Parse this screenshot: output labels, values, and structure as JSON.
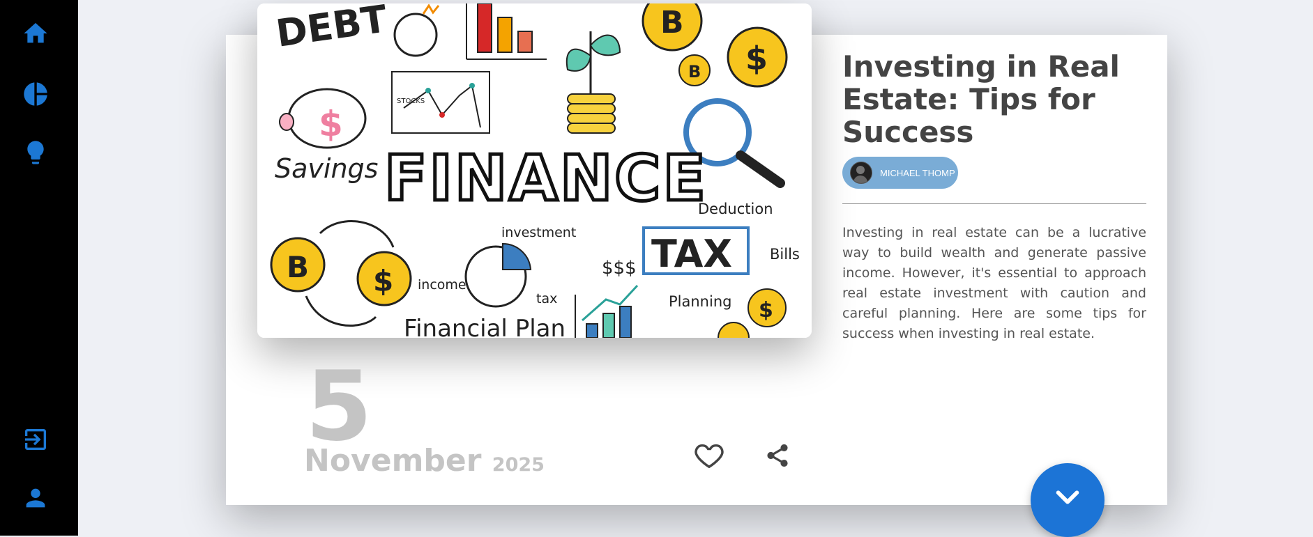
{
  "sidebar": {
    "items": [
      {
        "icon": "home-icon"
      },
      {
        "icon": "pie-chart-icon"
      },
      {
        "icon": "lightbulb-icon"
      },
      {
        "icon": "login-icon"
      },
      {
        "icon": "user-icon"
      }
    ],
    "icon_color": "#1c78d4"
  },
  "post": {
    "hero_words": {
      "debt": "DEBT",
      "finance": "FINANCE",
      "savings": "Savings",
      "tax": "TAX",
      "deduction": "Deduction",
      "bills": "Bills",
      "planning": "Planning",
      "investment": "investment",
      "income": "income",
      "tax_small": "tax",
      "dollars": "$$$",
      "stocks": "STOCKS",
      "financial_plan": "Financial Plan",
      "dollar_sign": "$",
      "bitcoin_sign": "B"
    },
    "date": {
      "day": "5",
      "month": "November",
      "year": "2025"
    },
    "title": "Investing in Real Estate: Tips for Success",
    "author": "MICHAEL THOMP",
    "excerpt": "Investing in real estate can be a lucrative way to build wealth and generate passive income. However, it's essential to approach real estate investment with caution and careful planning. Here are some tips for success when investing in real estate.",
    "accent": "#1c74d6",
    "author_badge_color": "#7aacd6"
  }
}
